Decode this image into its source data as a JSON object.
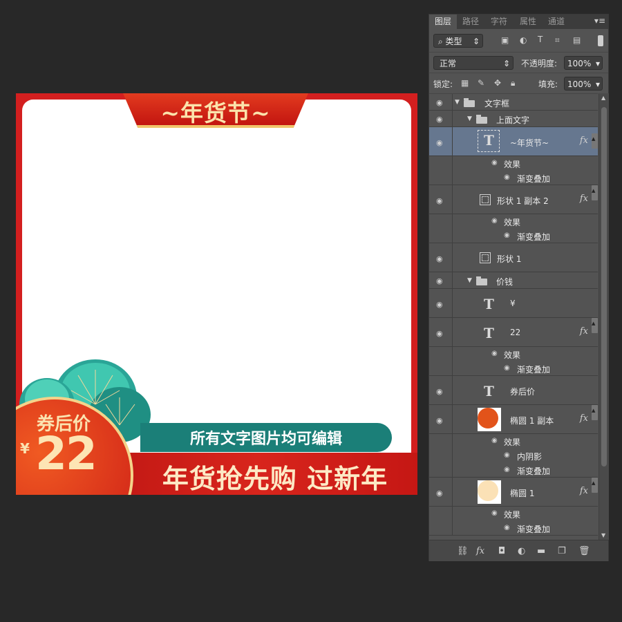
{
  "artwork": {
    "title": "~年货节~",
    "coupon_label": "券后价",
    "currency": "¥",
    "price": "22",
    "pill_text": "所有文字图片均可编辑",
    "slogan": "年货抢先购 过新年"
  },
  "panel": {
    "tabs": [
      "图层",
      "路径",
      "字符",
      "属性",
      "通道"
    ],
    "filter_kind": "类型",
    "blend_mode": "正常",
    "opacity_label": "不透明度:",
    "opacity_value": "100%",
    "lock_label": "锁定:",
    "fill_label": "填充:",
    "fill_value": "100%",
    "fx_label": "fx",
    "layers": {
      "group_textbox": "文字框",
      "group_top_text": "上面文字",
      "text_title": "~年货节~",
      "effects": "效果",
      "gradient_overlay": "渐变叠加",
      "inner_shadow": "内阴影",
      "shape_copy2": "形状 1 副本 2",
      "shape1": "形状 1",
      "group_price": "价钱",
      "text_yen": "¥",
      "text_22": "22",
      "text_coupon": "券后价",
      "ellipse_copy": "椭圆 1 副本",
      "ellipse1": "椭圆 1"
    }
  },
  "colors": {
    "frame_red": "#d31f1f",
    "teal": "#1b7f78",
    "gold": "#f4d38a",
    "panel_bg": "#535353",
    "selected_row": "#66778f"
  }
}
